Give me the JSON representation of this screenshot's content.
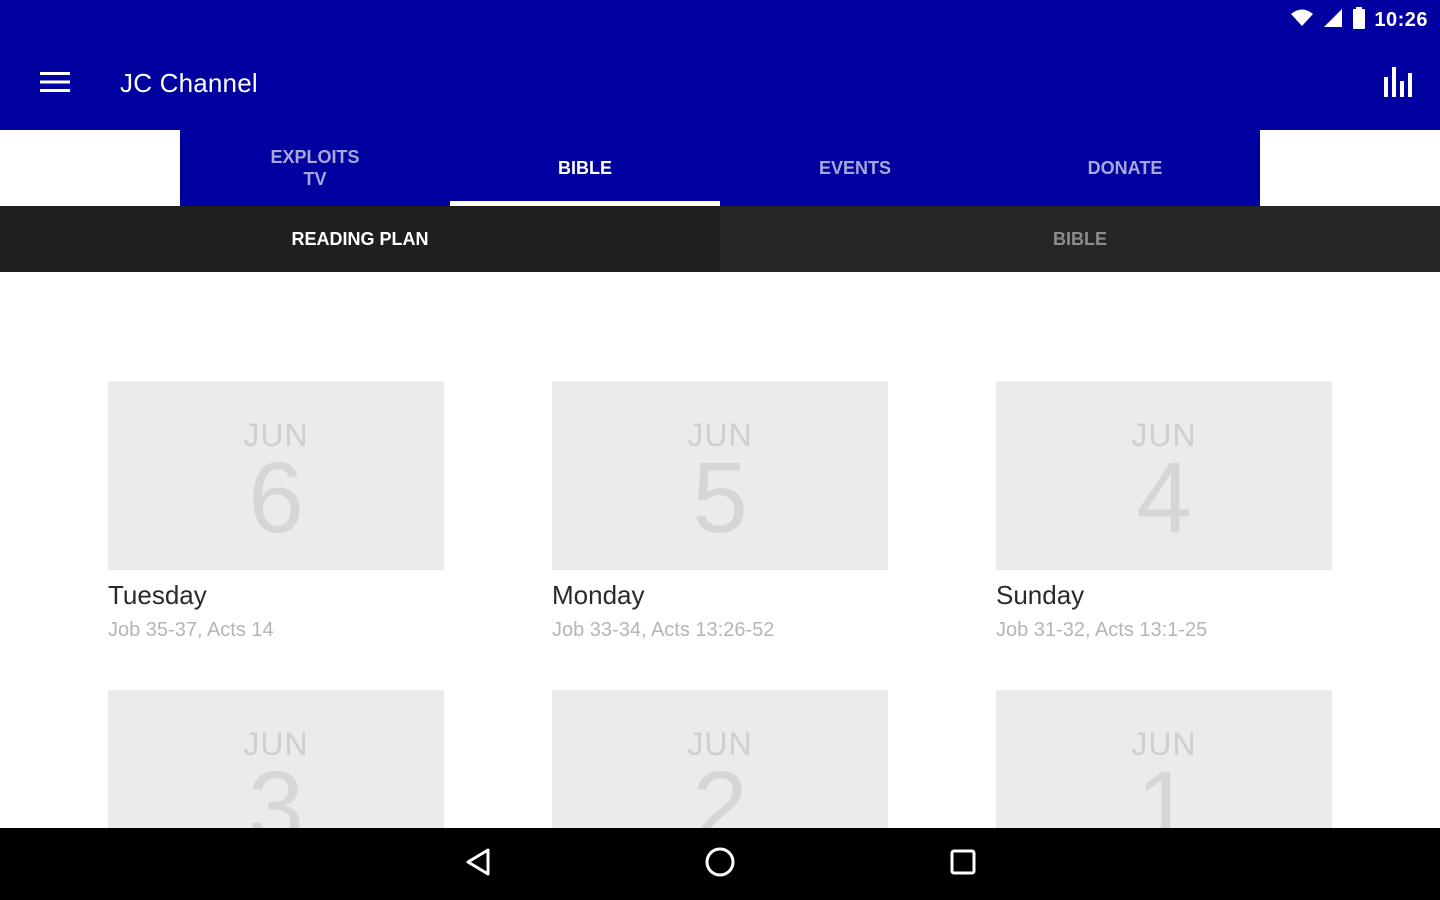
{
  "status_bar": {
    "time": "10:26",
    "icons": [
      "wifi-icon",
      "signal-icon",
      "battery-icon"
    ]
  },
  "app_bar": {
    "title": "JC Channel",
    "menu_icon": "hamburger-menu-icon",
    "action_icon": "bar-chart-icon"
  },
  "tabs": [
    {
      "label_line1": "EXPLOITS",
      "label_line2": "TV",
      "active": false
    },
    {
      "label": "BIBLE",
      "active": true
    },
    {
      "label": "EVENTS",
      "active": false
    },
    {
      "label": "DONATE",
      "active": false
    }
  ],
  "subtabs": [
    {
      "label": "READING PLAN",
      "active": true
    },
    {
      "label": "BIBLE",
      "active": false
    }
  ],
  "readings": [
    {
      "month": "JUN",
      "day": "6",
      "weekday": "Tuesday",
      "passage": "Job 35-37, Acts 14"
    },
    {
      "month": "JUN",
      "day": "5",
      "weekday": "Monday",
      "passage": "Job 33-34, Acts 13:26-52"
    },
    {
      "month": "JUN",
      "day": "4",
      "weekday": "Sunday",
      "passage": "Job 31-32, Acts 13:1-25"
    },
    {
      "month": "JUN",
      "day": "3",
      "weekday": "",
      "passage": ""
    },
    {
      "month": "JUN",
      "day": "2",
      "weekday": "",
      "passage": ""
    },
    {
      "month": "JUN",
      "day": "1",
      "weekday": "",
      "passage": ""
    }
  ],
  "nav_bar": {
    "icons": [
      "back-icon",
      "home-icon",
      "recents-icon"
    ]
  },
  "colors": {
    "primary": "#0000a0",
    "subtab_bg": "#222222",
    "tile_bg": "#ebebeb"
  }
}
